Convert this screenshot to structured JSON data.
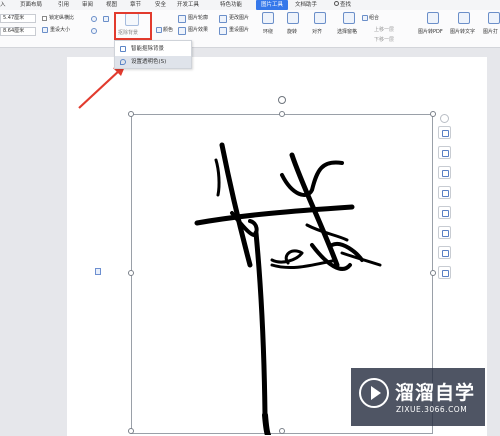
{
  "tabs": [
    "入",
    "页面布局",
    "引用",
    "审阅",
    "视图",
    "章节",
    "安全",
    "开发工具",
    "特色功能",
    "图片工具",
    "文档助手",
    "查找"
  ],
  "active_tab": "图片工具",
  "ribbon": {
    "width_value": "5.47厘米",
    "height_value": "8.64厘米",
    "lock_ratio": "锁定纵横比",
    "reset_size": "重设大小",
    "remove_bg": "抠除背景",
    "color": "颜色",
    "outline": "图片轮廓",
    "effects": "图片效果",
    "change_pic": "更改图片",
    "reset_pic": "重设图片",
    "wrap": "环绕",
    "rotate": "旋转",
    "align": "对齐",
    "select_pane": "选择窗格",
    "group": "组合",
    "up_one": "上移一层",
    "down_one": "下移一层",
    "to_pdf": "图片转PDF",
    "to_text": "图片转文字",
    "print": "图片打"
  },
  "dropdown": {
    "item1": "智能抠除背景",
    "item2": "设置透明色(S)"
  },
  "watermark": {
    "title": "溜溜自学",
    "url": "ZIXUE.3066.COM"
  },
  "colors": {
    "accent": "#3578ea",
    "highlight": "#e23b2e"
  }
}
